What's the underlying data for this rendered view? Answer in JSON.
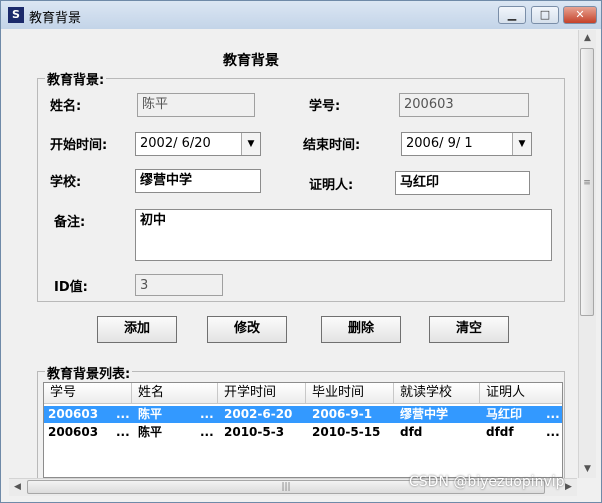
{
  "window": {
    "title": "教育背景",
    "minimize": "▁",
    "maximize": "□",
    "close": "✕",
    "icon_char": "S"
  },
  "form": {
    "page_title": "教育背景",
    "group_title": "教育背景:",
    "name_label": "姓名:",
    "name_value": "陈平",
    "student_no_label": "学号:",
    "student_no_value": "200603",
    "start_label": "开始时间:",
    "start_value": "2002/ 6/20",
    "end_label": "结束时间:",
    "end_value": "2006/ 9/ 1",
    "school_label": "学校:",
    "school_value": "缪营中学",
    "witness_label": "证明人:",
    "witness_value": "马红印",
    "note_label": "备注:",
    "note_value": "初中",
    "id_label": "ID值:",
    "id_value": "3"
  },
  "buttons": {
    "add": "添加",
    "edit": "修改",
    "delete": "删除",
    "clear": "清空"
  },
  "list": {
    "title": "教育背景列表:",
    "columns": [
      "学号",
      "姓名",
      "开学时间",
      "毕业时间",
      "就读学校",
      "证明人"
    ],
    "rows": [
      {
        "student_no": "200603",
        "name": "陈平",
        "start": "2002-6-20",
        "end": "2006-9-1",
        "school": "缪营中学",
        "witness": "马红印",
        "selected": true
      },
      {
        "student_no": "200603",
        "name": "陈平",
        "start": "2010-5-3",
        "end": "2010-5-15",
        "school": "dfd",
        "witness": "dfdf",
        "selected": false
      }
    ],
    "ellipsis": "..."
  },
  "scroll": {
    "up": "▲",
    "down": "▼",
    "left": "◀",
    "right": "▶",
    "grip_v": "≡",
    "grip_h": "|||"
  },
  "watermark": "CSDN @biyezuopinvip"
}
